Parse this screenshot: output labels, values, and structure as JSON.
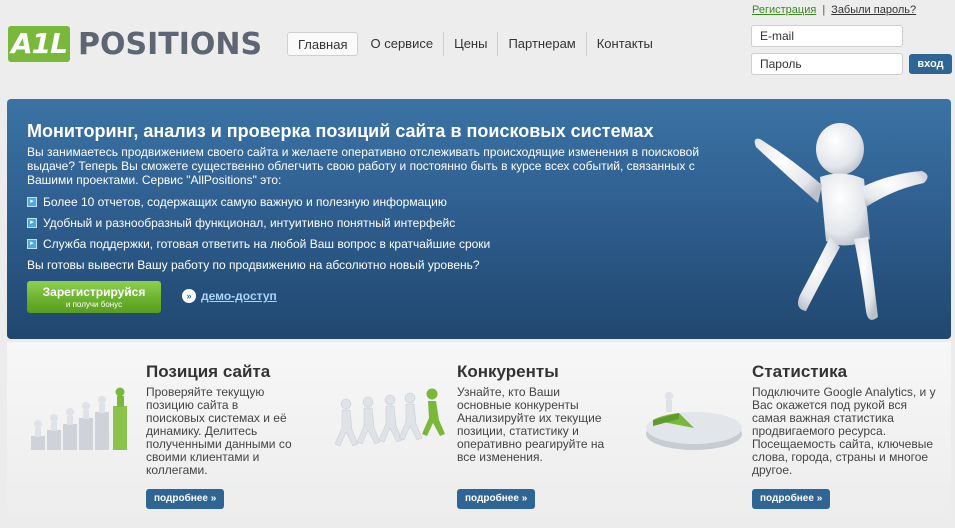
{
  "brand": {
    "badge": "A1L",
    "name": "POSITIONS"
  },
  "nav": {
    "items": [
      "Главная",
      "О сервисе",
      "Цены",
      "Партнерам",
      "Контакты"
    ],
    "active": "Главная"
  },
  "auth": {
    "register_link": "Регистрация",
    "separator": "|",
    "forgot_link": "Забыли пароль?",
    "email_placeholder": "E-mail",
    "password_placeholder": "Пароль",
    "login_button": "вход"
  },
  "hero": {
    "title": "Мониторинг, анализ и проверка позиций сайта в поисковых системах",
    "intro": "Вы занимаетесь продвижением своего сайта и желаете оперативно отслеживать происходящие изменения в поисковой выдаче? Теперь Вы сможете существенно облегчить свою работу и постоянно быть в курсе всех событий, связанных с Вашими проектами. Сервис \"AllPositions\" это:",
    "bullets": [
      "Более 10 отчетов, содержащих самую важную и полезную информацию",
      "Удобный и разнообразный функционал, интуитивно понятный интерфейс",
      "Служба поддержки, готовая ответить на любой Ваш вопрос в кратчайшие сроки"
    ],
    "question": "Вы готовы вывести Вашу работу по продвижению на абсолютно новый уровень?",
    "register_main": "Зарегистрируйся",
    "register_sub": "и получи бонус",
    "demo_link": "демо-доступ"
  },
  "features": [
    {
      "title": "Позиция сайта",
      "desc": "Проверяйте текущую позицию сайта в поисковых системах и её динамику. Делитесь полученными данными со своими клиентами и коллегами.",
      "button": "подробнее »",
      "icon": "staircase-people-icon"
    },
    {
      "title": "Конкуренты",
      "desc": "Узнайте, кто Ваши основные конкуренты Анализируйте их текущие позиции, статистику и оперативно реагируйте на все изменения.",
      "button": "подробнее »",
      "icon": "running-people-icon"
    },
    {
      "title": "Статистика",
      "desc": "Подключите Google Analytics, и у Вас окажется под рукой вся самая важная статистика продвигаемого ресурса. Посещаемость сайта, ключевые слова, города, страны и многое другое.",
      "button": "подробнее »",
      "icon": "pie-chart-person-icon"
    }
  ],
  "colors": {
    "accent_green": "#7ab83c",
    "hero_blue": "#2f5f90",
    "button_blue": "#2f6595"
  }
}
